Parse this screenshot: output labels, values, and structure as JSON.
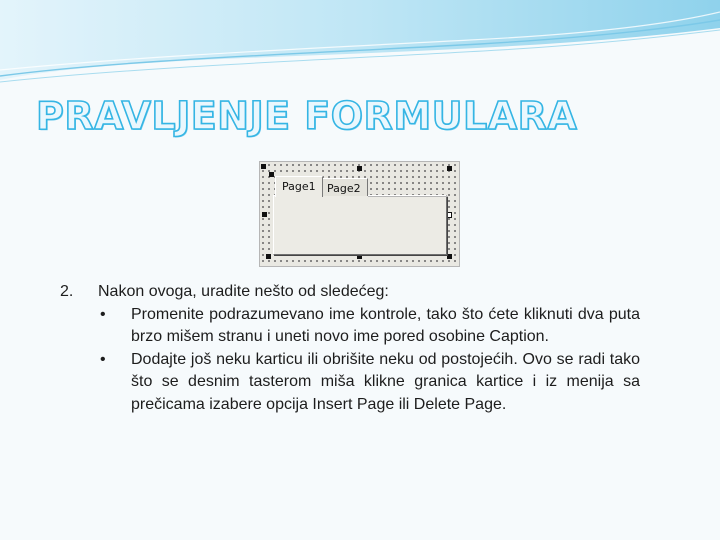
{
  "slide": {
    "title": "PRAVLJENJE FORMULARA"
  },
  "form_designer": {
    "tabs": [
      {
        "label": "Page1",
        "active": true
      },
      {
        "label": "Page2",
        "active": false
      }
    ]
  },
  "content": {
    "step_number": "2.",
    "step_text": "Nakon ovoga, uradite nešto od sledećeg:",
    "bullet_symbol": "•",
    "bullets": [
      "Promenite podrazumevano ime kontrole, tako što ćete kliknuti dva puta brzo mišem stranu i uneti novo ime pored osobine Caption.",
      "Dodajte još neku karticu ili obrišite neku od postojećih. Ovo se radi tako što se desnim tasterom miša klikne granica kartice i iz menija sa prečicama izabere opcija Insert Page ili Delete Page."
    ]
  },
  "colors": {
    "title_outline": "#35b5e4",
    "header_wave": "#9fd8ee",
    "background": "#f6fafc"
  }
}
